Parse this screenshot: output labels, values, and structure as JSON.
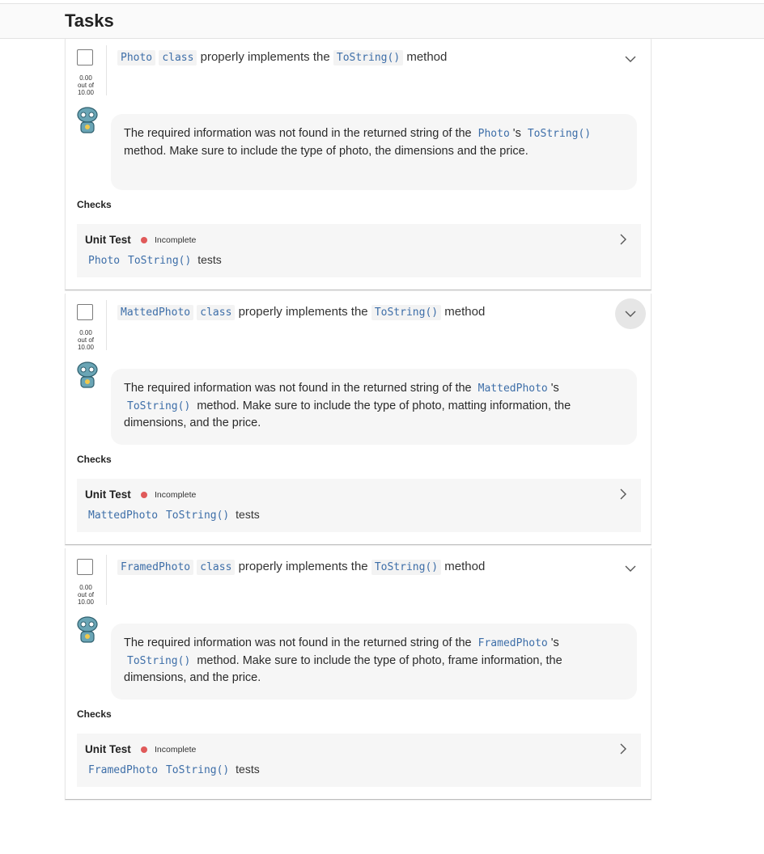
{
  "header": {
    "title": "Tasks"
  },
  "tasks": [
    {
      "class_name": "Photo",
      "keyword": "class",
      "title_text": "properly implements the",
      "method": "ToString()",
      "title_suffix": "method",
      "score": {
        "value": "0.00",
        "out_of": "out of",
        "max": "10.00"
      },
      "feedback": {
        "prefix": "The required information was not found in the returned string of the",
        "class_name": "Photo",
        "possessive": "'s",
        "method": "ToString()",
        "suffix": "method. Make sure to include the type of photo, the dimensions and the price."
      },
      "checks_label": "Checks",
      "unit_test": {
        "title": "Unit Test",
        "status": "Incomplete",
        "class_name": "Photo",
        "method": "ToString()",
        "suffix": "tests"
      }
    },
    {
      "class_name": "MattedPhoto",
      "keyword": "class",
      "title_text": "properly implements the",
      "method": "ToString()",
      "title_suffix": "method",
      "score": {
        "value": "0.00",
        "out_of": "out of",
        "max": "10.00"
      },
      "feedback": {
        "prefix": "The required information was not found in the returned string of the",
        "class_name": "MattedPhoto",
        "possessive": "'s",
        "method": "ToString()",
        "suffix": "method. Make sure to include the type of photo, matting information, the dimensions, and the price."
      },
      "checks_label": "Checks",
      "unit_test": {
        "title": "Unit Test",
        "status": "Incomplete",
        "class_name": "MattedPhoto",
        "method": "ToString()",
        "suffix": "tests"
      }
    },
    {
      "class_name": "FramedPhoto",
      "keyword": "class",
      "title_text": "properly implements the",
      "method": "ToString()",
      "title_suffix": "method",
      "score": {
        "value": "0.00",
        "out_of": "out of",
        "max": "10.00"
      },
      "feedback": {
        "prefix": "The required information was not found in the returned string of the",
        "class_name": "FramedPhoto",
        "possessive": "'s",
        "method": "ToString()",
        "suffix": "method. Make sure to include the type of photo, frame information, the dimensions, and the price."
      },
      "checks_label": "Checks",
      "unit_test": {
        "title": "Unit Test",
        "status": "Incomplete",
        "class_name": "FramedPhoto",
        "method": "ToString()",
        "suffix": "tests"
      }
    }
  ],
  "colors": {
    "code": "#3d6ea8",
    "incomplete_dot": "#e05a5a",
    "feedback_bg": "#f6f6f6"
  },
  "icons": {
    "expand": "chevron-down-icon",
    "open_check": "chevron-right-icon",
    "avatar": "robot-avatar-icon"
  }
}
